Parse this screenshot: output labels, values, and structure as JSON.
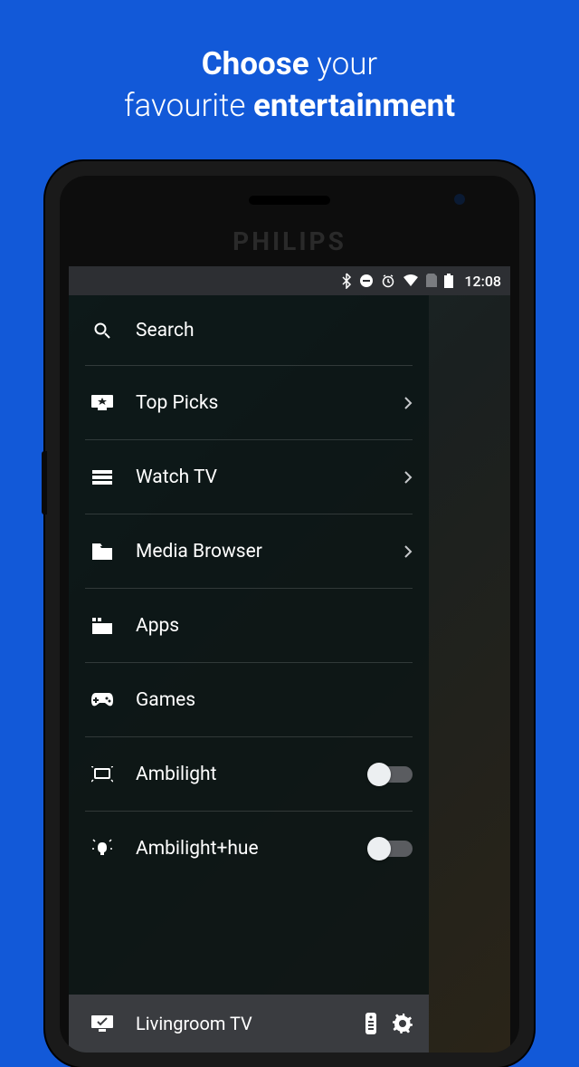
{
  "headline": {
    "l1a": "Choose",
    "l1b": " your",
    "l2a": "favourite ",
    "l2b": "entertainment"
  },
  "brand": "PHILIPS",
  "status": {
    "time": "12:08"
  },
  "menu": {
    "search": "Search",
    "top_picks": "Top Picks",
    "watch_tv": "Watch TV",
    "media_browser": "Media Browser",
    "apps": "Apps",
    "games": "Games",
    "ambilight": "Ambilight",
    "ambilight_hue": "Ambilight+hue"
  },
  "bottom": {
    "device": "Livingroom TV"
  },
  "toggles": {
    "ambilight": false,
    "ambilight_hue": false
  }
}
